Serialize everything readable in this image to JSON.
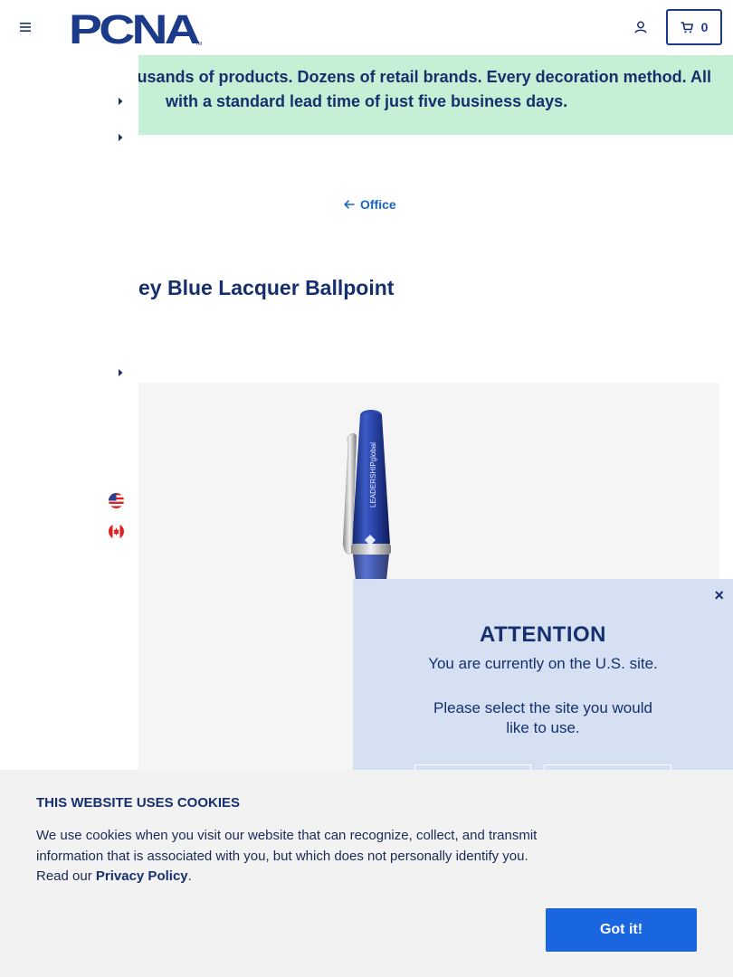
{
  "header": {
    "logo_text": "PCNA",
    "logo_tm": "TM",
    "cart_count": "0",
    "brand_color": "#1b3a8a"
  },
  "banner": {
    "line1": "usands of products. Dozens of retail brands. Every decoration method. All",
    "line2": "with a standard lead time of just five business days.",
    "background": "#c6f0d5"
  },
  "breadcrumb": {
    "label": "Office"
  },
  "product": {
    "title": "ey Blue Lacquer Ballpoint",
    "pen_imprint": "LEADERSHIPglobal"
  },
  "modal": {
    "close_label": "×",
    "title": "ATTENTION",
    "current_site": "You are currently on the U.S. site.",
    "select_text": "Please select the site you would like to use."
  },
  "cookie": {
    "title": "THIS WEBSITE USES COOKIES",
    "text": "We use cookies when you visit our website that can recognize, collect, and transmit information that is associated with you, but which does not personally identify you. Read our",
    "link_label": "Privacy Policy",
    "period": ".",
    "button_label": "Got it!"
  },
  "icons": [
    "menu-icon",
    "account-icon",
    "cart-icon",
    "caret-right-icon",
    "arrow-left-icon",
    "us-flag-icon",
    "canada-flag-icon",
    "close-icon"
  ]
}
